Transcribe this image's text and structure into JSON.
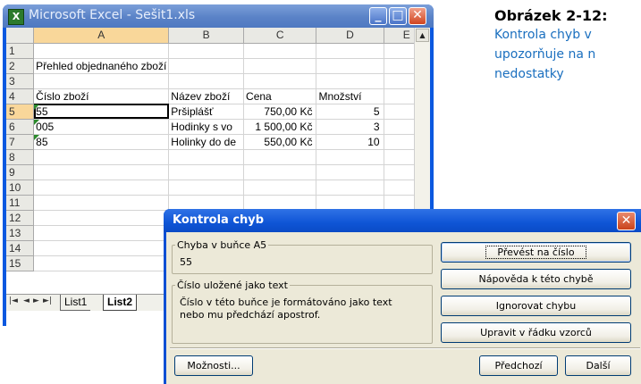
{
  "excel": {
    "title": "Microsoft Excel - Sešit1.xls",
    "app_icon": "X",
    "caption_buttons": {
      "minimize": "_",
      "maximize": "□",
      "close": "✕"
    },
    "columns": [
      "A",
      "B",
      "C",
      "D",
      "E"
    ],
    "rows": [
      {
        "num": "1",
        "cells": [
          "",
          "",
          "",
          "",
          ""
        ]
      },
      {
        "num": "2",
        "cells": [
          "Přehled objednaného zboží",
          "",
          "",
          "",
          ""
        ]
      },
      {
        "num": "3",
        "cells": [
          "",
          "",
          "",
          "",
          ""
        ]
      },
      {
        "num": "4",
        "cells": [
          "Číslo zboží",
          "Název zboží",
          "Cena",
          "Množství",
          ""
        ]
      },
      {
        "num": "5",
        "cells": [
          "55",
          "Pršiplášť",
          "750,00 Kč",
          "5",
          ""
        ]
      },
      {
        "num": "6",
        "cells": [
          "005",
          "Hodinky s vo",
          "1 500,00 Kč",
          "3",
          ""
        ]
      },
      {
        "num": "7",
        "cells": [
          "85",
          "Holinky do de",
          "550,00 Kč",
          "10",
          ""
        ]
      },
      {
        "num": "8",
        "cells": [
          "",
          "",
          "",
          "",
          ""
        ]
      },
      {
        "num": "9",
        "cells": [
          "",
          "",
          "",
          "",
          ""
        ]
      },
      {
        "num": "10",
        "cells": [
          "",
          "",
          "",
          "",
          ""
        ]
      },
      {
        "num": "11",
        "cells": [
          "",
          "",
          "",
          "",
          ""
        ]
      },
      {
        "num": "12",
        "cells": [
          "",
          "",
          "",
          "",
          ""
        ]
      },
      {
        "num": "13",
        "cells": [
          "",
          "",
          "",
          "",
          ""
        ]
      },
      {
        "num": "14",
        "cells": [
          "",
          "",
          "",
          "",
          ""
        ]
      },
      {
        "num": "15",
        "cells": [
          "",
          "",
          "",
          "",
          ""
        ]
      }
    ],
    "active_cell": "A5",
    "sheet_tabs": [
      "List1",
      "List2"
    ],
    "active_tab": "List2",
    "tab_nav": [
      "|◄",
      "◄",
      "►",
      "►|"
    ]
  },
  "dialog": {
    "title": "Kontrola chyb",
    "close_glyph": "✕",
    "error_group_label": "Chyba v buňce A5",
    "error_value": "55",
    "desc_group_label": "Číslo uložené jako text",
    "desc_text": "Číslo v této buňce je formátováno jako text nebo mu předchází apostrof.",
    "buttons": {
      "convert": "Převést na číslo",
      "help": "Nápověda k této chybě",
      "ignore": "Ignorovat chybu",
      "edit": "Upravit v řádku vzorců",
      "options": "Možnosti...",
      "previous": "Předchozí",
      "next": "Další"
    }
  },
  "caption": {
    "title": "Obrázek 2-12:",
    "lines": [
      "Kontrola chyb v",
      "upozorňuje na n",
      "nedostatky"
    ]
  },
  "icons": {
    "app": "excel-app-icon",
    "minimize": "minimize-icon",
    "maximize": "maximize-icon",
    "close": "close-icon",
    "scroll_up": "scroll-up-arrow-icon",
    "error_indicator": "error-indicator-triangle-icon"
  },
  "colors": {
    "caption": "#1a6fbf",
    "error_triangle": "#2b8a2b",
    "xp_blue": "#0b4fd4"
  }
}
